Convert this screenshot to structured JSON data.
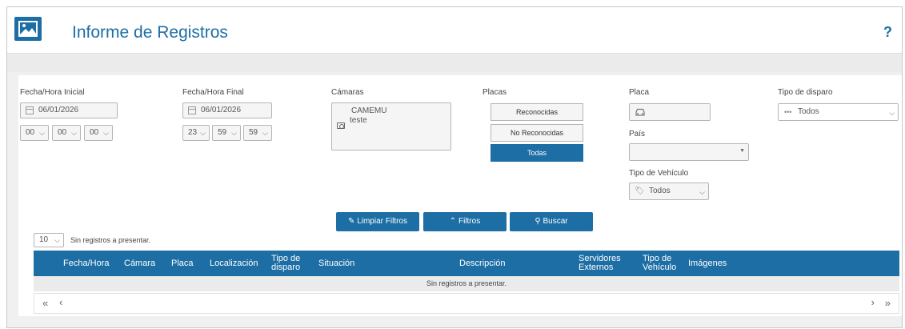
{
  "header": {
    "title": "Informe de Registros",
    "help": "?"
  },
  "filters": {
    "fecha_inicial": {
      "label": "Fecha/Hora Inicial",
      "date": "06/01/2026",
      "hh": "00",
      "mm": "00",
      "ss": "00"
    },
    "fecha_final": {
      "label": "Fecha/Hora Final",
      "date": "06/01/2026",
      "hh": "23",
      "mm": "59",
      "ss": "59"
    },
    "camaras": {
      "label": "Cámaras",
      "items": [
        "CAMEMU",
        "teste"
      ]
    },
    "placas": {
      "label": "Placas",
      "options": [
        "Reconocidas",
        "No Reconocidas",
        "Todas"
      ],
      "selected": "Todas"
    },
    "placa": {
      "label": "Placa",
      "value": ""
    },
    "pais": {
      "label": "País",
      "value": ""
    },
    "tipo_vehiculo": {
      "label": "Tipo de Vehículo",
      "value": "Todos"
    },
    "tipo_disparo": {
      "label": "Tipo de disparo",
      "value": "Todos"
    }
  },
  "actions": {
    "limpiar": "Limpiar Filtros",
    "filtros": "Filtros",
    "buscar": "Buscar"
  },
  "table": {
    "page_size": "10",
    "info": "Sin registros a presentar.",
    "columns": [
      "Fecha/Hora",
      "Cámara",
      "Placa",
      "Localización",
      "Tipo de disparo",
      "Situación",
      "Descripción",
      "Servidores Externos",
      "Tipo de Vehículo",
      "Imágenes"
    ],
    "empty_message": "Sin registros a presentar.",
    "pager": {
      "first": "«",
      "prev": "‹",
      "next": "›",
      "last": "»"
    }
  },
  "colors": {
    "accent": "#1d6ea5"
  }
}
